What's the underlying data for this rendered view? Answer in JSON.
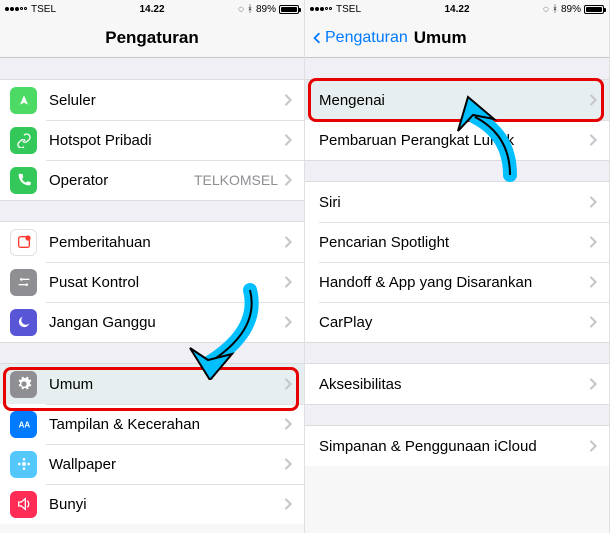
{
  "statusbar": {
    "carrier": "TSEL",
    "time": "14.22",
    "bt_icon": "bluetooth",
    "battery": "89%",
    "loading_icon": "loading"
  },
  "left": {
    "title": "Pengaturan",
    "groups": [
      [
        {
          "icon": "antenna",
          "color": "ic-green",
          "label": "Seluler"
        },
        {
          "icon": "link",
          "color": "ic-green2",
          "label": "Hotspot Pribadi"
        },
        {
          "icon": "phone",
          "color": "ic-green2",
          "label": "Operator",
          "detail": "TELKOMSEL"
        }
      ],
      [
        {
          "icon": "bell",
          "color": "ic-red",
          "label": "Pemberitahuan"
        },
        {
          "icon": "switches",
          "color": "ic-grey",
          "label": "Pusat Kontrol"
        },
        {
          "icon": "moon",
          "color": "ic-purple",
          "label": "Jangan Ganggu"
        }
      ],
      [
        {
          "icon": "gear",
          "color": "ic-grey2",
          "label": "Umum",
          "highlight": true
        },
        {
          "icon": "aa",
          "color": "ic-blue",
          "label": "Tampilan & Kecerahan"
        },
        {
          "icon": "flower",
          "color": "ic-cyan",
          "label": "Wallpaper"
        },
        {
          "icon": "sound",
          "color": "ic-pink",
          "label": "Bunyi"
        }
      ]
    ]
  },
  "right": {
    "back": "Pengaturan",
    "title": "Umum",
    "groups": [
      [
        {
          "label": "Mengenai",
          "highlight": true
        },
        {
          "label": "Pembaruan Perangkat Lunak"
        }
      ],
      [
        {
          "label": "Siri"
        },
        {
          "label": "Pencarian Spotlight"
        },
        {
          "label": "Handoff & App yang Disarankan"
        },
        {
          "label": "CarPlay"
        }
      ],
      [
        {
          "label": "Aksesibilitas"
        }
      ],
      [
        {
          "label": "Simpanan & Penggunaan iCloud"
        }
      ]
    ]
  }
}
